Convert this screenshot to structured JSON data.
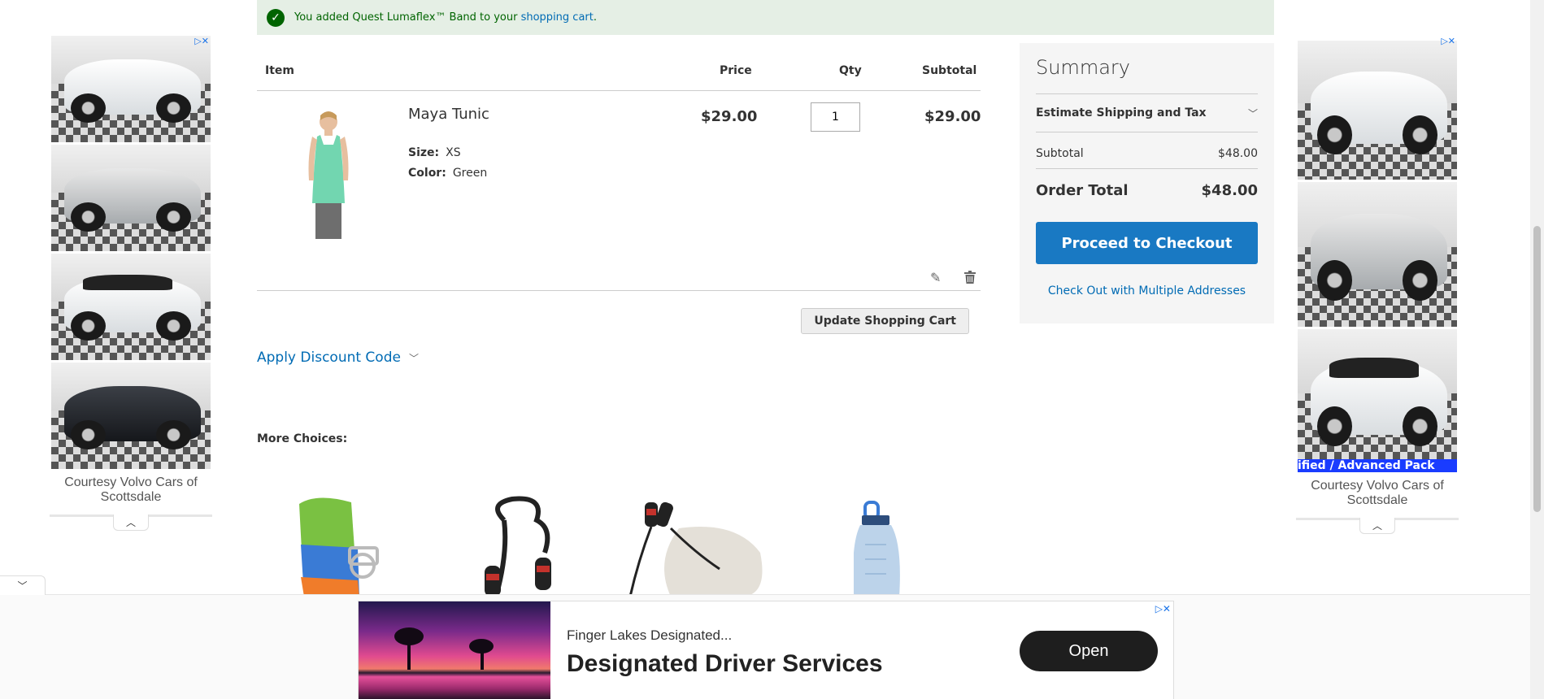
{
  "message": {
    "text_before": "You added Quest Lumaflex™ Band to your ",
    "link": "shopping cart",
    "text_after": "."
  },
  "cart": {
    "columns": {
      "item": "Item",
      "price": "Price",
      "qty": "Qty",
      "subtotal": "Subtotal"
    },
    "item": {
      "name": "Maya Tunic",
      "size_label": "Size:",
      "size_value": "XS",
      "color_label": "Color:",
      "color_value": "Green",
      "price": "$29.00",
      "qty": "1",
      "subtotal": "$29.00"
    },
    "update_button": "Update Shopping Cart",
    "discount_label": "Apply Discount Code",
    "more_choices": "More Choices:"
  },
  "summary": {
    "title": "Summary",
    "estimate": "Estimate Shipping and Tax",
    "subtotal_label": "Subtotal",
    "subtotal_value": "$48.00",
    "total_label": "Order Total",
    "total_value": "$48.00",
    "checkout_button": "Proceed to Checkout",
    "multi_link": "Check Out with Multiple Addresses"
  },
  "side_ads": {
    "left_caption": "Courtesy Volvo Cars of Scottsdale",
    "right_caption": "Courtesy Volvo Cars of Scottsdale",
    "right_banner": "ified / Advanced Pack"
  },
  "anchor_ad": {
    "subtitle": "Finger Lakes Designated...",
    "title": "Designated Driver Services",
    "button": "Open"
  },
  "colors": {
    "accent": "#1979c3",
    "link": "#006bb4",
    "success_bg": "#e5efe5",
    "success_text": "#006400"
  }
}
